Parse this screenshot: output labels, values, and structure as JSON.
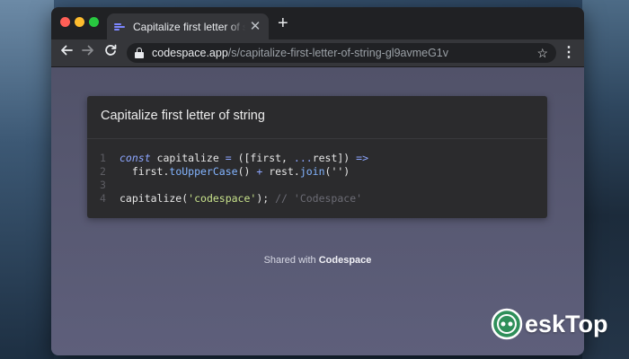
{
  "browser": {
    "tab_title": "Capitalize first letter of string | Codespace",
    "tab_close": "✕",
    "new_tab": "+",
    "url_host": "codespace.app",
    "url_path": "/s/capitalize-first-letter-of-string-gl9avmeG1v",
    "icons": {
      "back": "arrow-left-icon",
      "forward": "arrow-right-icon",
      "reload": "reload-icon",
      "lock": "lock-icon",
      "bookmark": "star-icon",
      "menu": "kebab-menu-icon"
    }
  },
  "snippet": {
    "title": "Capitalize first letter of string",
    "lines": [
      {
        "n": "1",
        "tokens": [
          {
            "t": "const",
            "c": "kw"
          },
          {
            "t": " capitalize ",
            "c": "plain"
          },
          {
            "t": "=",
            "c": "op"
          },
          {
            "t": " ([first, ",
            "c": "plain"
          },
          {
            "t": "...",
            "c": "op"
          },
          {
            "t": "rest]) ",
            "c": "plain"
          },
          {
            "t": "=>",
            "c": "op"
          }
        ]
      },
      {
        "n": "2",
        "tokens": [
          {
            "t": "  first.",
            "c": "plain"
          },
          {
            "t": "toUpperCase",
            "c": "fn"
          },
          {
            "t": "() ",
            "c": "plain"
          },
          {
            "t": "+",
            "c": "op"
          },
          {
            "t": " rest.",
            "c": "plain"
          },
          {
            "t": "join",
            "c": "fn"
          },
          {
            "t": "('')",
            "c": "plain"
          }
        ]
      },
      {
        "n": "3",
        "tokens": []
      },
      {
        "n": "4",
        "tokens": [
          {
            "t": "capitalize(",
            "c": "plain"
          },
          {
            "t": "'codespace'",
            "c": "str"
          },
          {
            "t": "); ",
            "c": "plain"
          },
          {
            "t": "// 'Codespace'",
            "c": "cmt"
          }
        ]
      }
    ]
  },
  "footer": {
    "shared_prefix": "Shared with ",
    "shared_brand": "Codespace"
  },
  "watermark": {
    "text": "eskTop"
  },
  "colors": {
    "accent": "#8da6ff",
    "string": "#c8e28b",
    "page_bg": "#55566e",
    "card_bg": "#2b2b2d"
  }
}
